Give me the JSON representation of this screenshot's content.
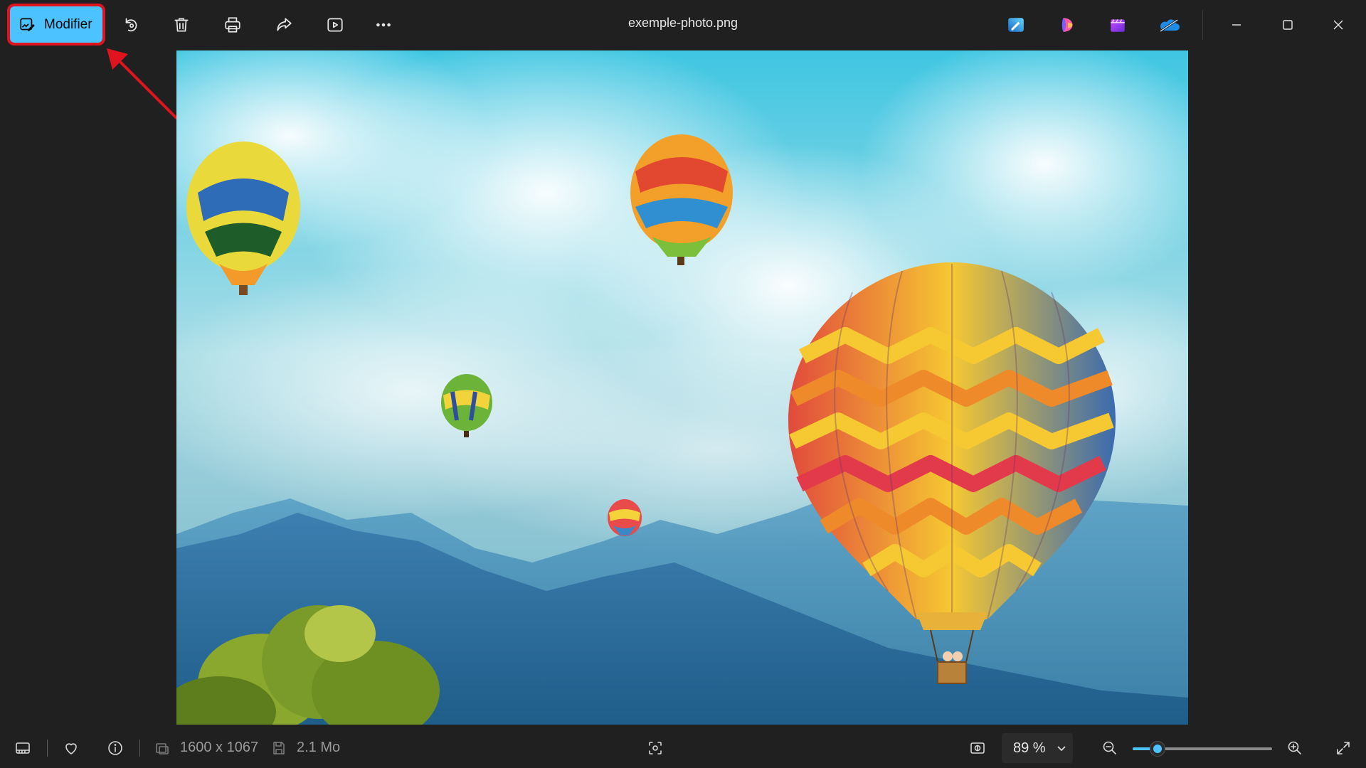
{
  "toolbar": {
    "edit_label": "Modifier",
    "edit_icon": "photo-edit-icon",
    "tools": [
      "rotate-icon",
      "delete-icon",
      "print-icon",
      "share-icon",
      "slideshow-icon",
      "more-options-icon"
    ]
  },
  "window": {
    "title": "exemple-photo.png",
    "apps": [
      "designer-icon",
      "copilot-icon",
      "clipchamp-icon",
      "onedrive-icon"
    ],
    "controls": [
      "minimize-icon",
      "maximize-icon",
      "close-icon"
    ]
  },
  "status": {
    "dimensions": "1600 x 1067",
    "file_size": "2.1 Mo",
    "zoom_label": "89 %",
    "zoom_level_percent": 18
  },
  "colors": {
    "accent": "#4cc2ff",
    "highlight": "#e0141e",
    "background": "#202020"
  }
}
